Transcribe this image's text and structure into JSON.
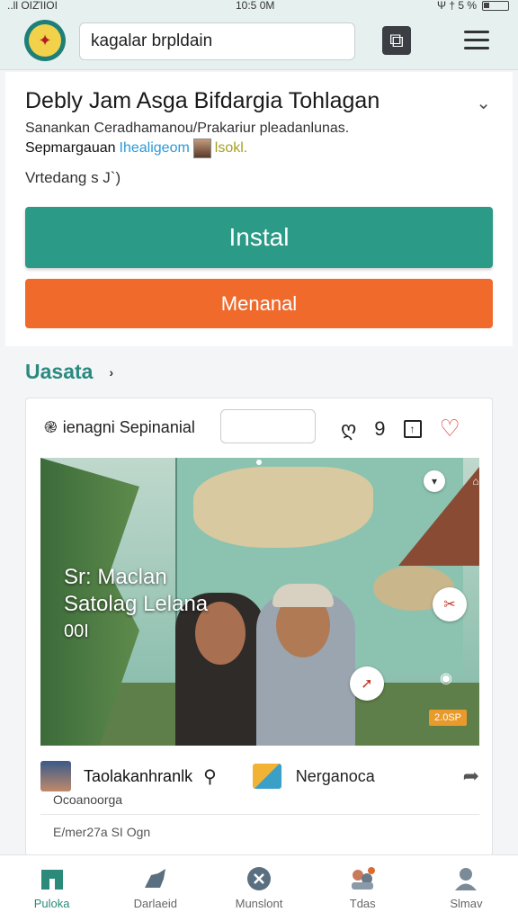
{
  "status_bar": {
    "left": "..ll ΟΙΖΊΙΟΙ",
    "time": "10:5 0M",
    "right": "Ψ † 5 %"
  },
  "header": {
    "search_value": "kagalar brpldain"
  },
  "app": {
    "title": "Debly Jam Asga Bifdargia Tohlagan",
    "subtitle": "Sanankan Ceradhamanou/Prakariur pleadanlunas.",
    "subtitle2_a": "Sepmargauan",
    "subtitle2_b": "Ihealigeom",
    "subtitle2_c": "lsokl.",
    "meta": "Vrtedang s J`)",
    "install_label": "Instal",
    "second_label": "Menanal"
  },
  "section": {
    "title": "Uasata",
    "arrow": "›"
  },
  "post": {
    "header_label": "ienagni Sepinanial",
    "photo_line1": "Sr: Maclan",
    "photo_line2": "Satolag Lelana",
    "photo_line3": "00I",
    "badge": "2.0SP",
    "author": "Taolakanhranlk",
    "tag": "Nerganoca",
    "meta1": "Ocoanoorga",
    "meta2": "E/mer27a SI Ogn"
  },
  "bottom_nav": [
    {
      "label": "Puloka",
      "icon": "home-icon"
    },
    {
      "label": "Darlaeid",
      "icon": "animal-icon"
    },
    {
      "label": "Munslont",
      "icon": "close-circle-icon"
    },
    {
      "label": "Tdas",
      "icon": "people-icon"
    },
    {
      "label": "Slmav",
      "icon": "profile-icon"
    }
  ],
  "colors": {
    "accent": "#2b9a86",
    "orange": "#f06a2c",
    "header_bg": "#e6f0ef"
  }
}
